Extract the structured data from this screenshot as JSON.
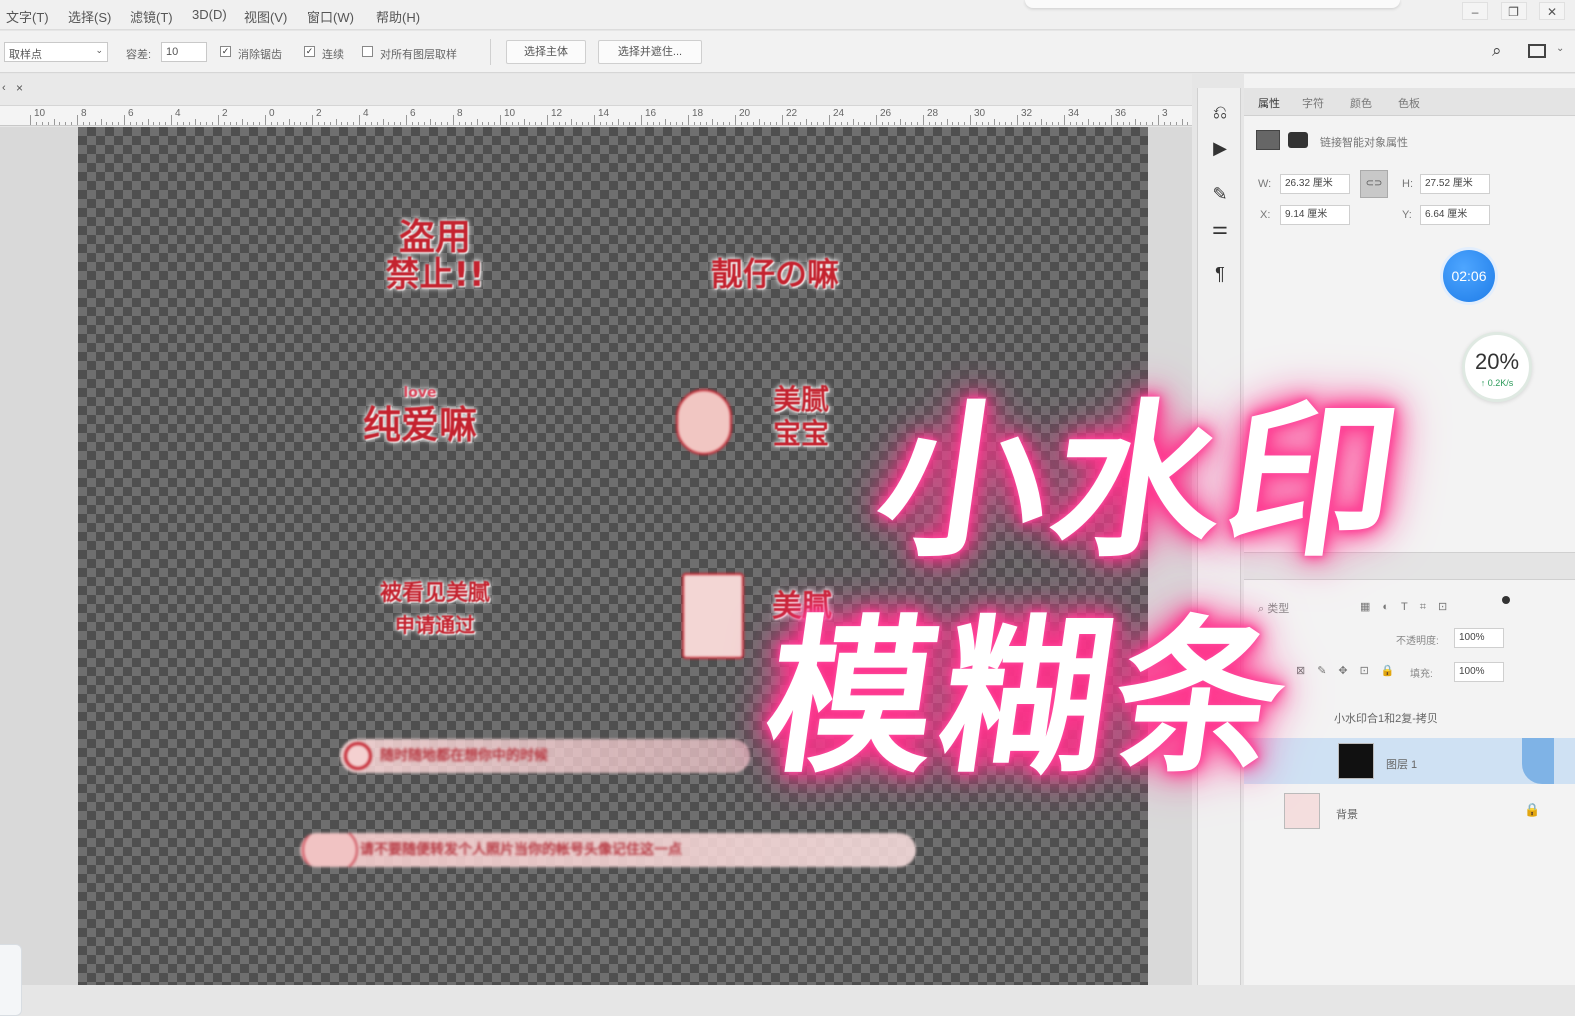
{
  "menu": {
    "items": [
      "文字(T)",
      "选择(S)",
      "滤镜(T)",
      "3D(D)",
      "视图(V)",
      "窗口(W)",
      "帮助(H)"
    ],
    "window_controls": [
      "–",
      "❐",
      "✕"
    ]
  },
  "options_bar": {
    "tool_preset": "取样点",
    "tolerance_label": "容差:",
    "tolerance_value": "10",
    "antialias_label": "消除锯齿",
    "antialias_checked": "✓",
    "contiguous_label": "连续",
    "contiguous_checked": "✓",
    "sample_all_label": "对所有图层取样",
    "select_subject_label": "选择主体",
    "select_mask_label": "选择并遮住..."
  },
  "doc_tab": {
    "close_label": "×",
    "arrows": "‹"
  },
  "ruler": {
    "labels": [
      "10",
      "8",
      "6",
      "4",
      "2",
      "0",
      "2",
      "4",
      "6",
      "8",
      "10",
      "12",
      "14",
      "16",
      "18",
      "20",
      "22",
      "24",
      "26",
      "28",
      "30",
      "32",
      "34",
      "36",
      "3"
    ]
  },
  "canvas": {
    "stickers": [
      {
        "line1": "盗用",
        "line2": "禁止!!"
      },
      {
        "line1": "靓仔の嘛",
        "line2": ""
      },
      {
        "line1": "纯爱嘛",
        "line2": "love"
      },
      {
        "line1": "美腻",
        "line2": "宝宝"
      },
      {
        "line1": "被看见美腻",
        "line2": "申请通过"
      },
      {
        "line1": "美腻",
        "line2": ""
      }
    ],
    "strip1_text": "随时随地都在想你中的时候",
    "strip2_text": "请不要随便转发个人照片当你的帐号头像记住这一点"
  },
  "tools": {
    "icons": [
      "history-icon",
      "play-icon",
      "brush-settings-icon",
      "adjust-icon",
      "paragraph-icon"
    ]
  },
  "properties_panel": {
    "tabs": [
      "属性",
      "字符",
      "颜色",
      "色板"
    ],
    "header_text": "链接智能对象属性",
    "w_label": "W:",
    "w_value": "26.32 厘米",
    "h_label": "H:",
    "h_value": "27.52 厘米",
    "x_label": "X:",
    "x_value": "9.14 厘米",
    "y_label": "Y:",
    "y_value": "6.64 厘米",
    "link_label": "⊂⊃"
  },
  "widgets": {
    "timer": "02:06",
    "percent": "20%",
    "percent_sub": "↑ 0.2K/s"
  },
  "layers_panel": {
    "filter_label": "类型",
    "opacity_label": "不透明度:",
    "opacity_value": "100%",
    "fill_label": "填充:",
    "fill_value": "100%",
    "layers": [
      {
        "name": "小水印合1和2复-拷贝"
      },
      {
        "name": "图层 1"
      },
      {
        "name": "背景"
      }
    ]
  },
  "overlay": {
    "line1": "小水印",
    "line2": "模糊条"
  }
}
